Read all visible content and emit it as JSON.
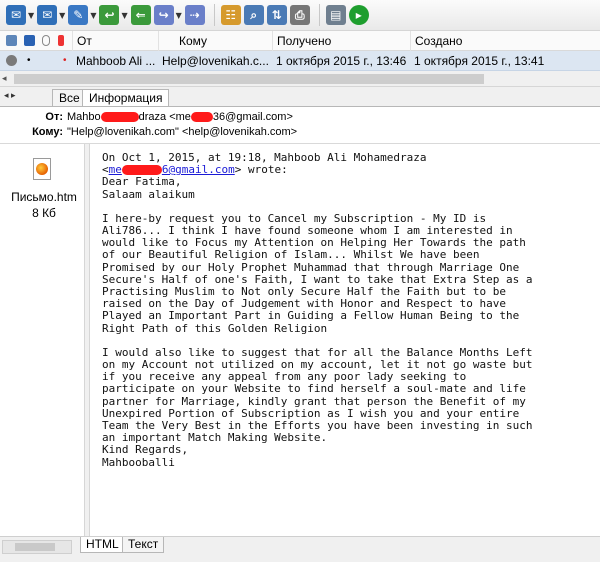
{
  "toolbar": {
    "buttons": [
      {
        "icon": "receive-mail-icon",
        "has_menu": true,
        "color": "#2f6fb8"
      },
      {
        "icon": "send-mail-icon",
        "has_menu": true,
        "color": "#2f6fb8"
      },
      {
        "icon": "new-message-icon",
        "has_menu": true,
        "color": "#3a78c4"
      },
      {
        "icon": "reply-icon",
        "has_menu": true,
        "color": "#3b9a3b"
      },
      {
        "icon": "reply-all-icon",
        "has_menu": false,
        "color": "#3b9a3b"
      },
      {
        "icon": "forward-icon",
        "has_menu": true,
        "color": "#6a7fc9"
      },
      {
        "icon": "redirect-icon",
        "has_menu": false,
        "color": "#6a7fc9"
      },
      {
        "icon": "address-book-icon",
        "has_menu": false,
        "color": "#d69a2d"
      },
      {
        "icon": "find-icon",
        "has_menu": false,
        "color": "#4a7ab5"
      },
      {
        "icon": "send-receive-icon",
        "has_menu": false,
        "color": "#4a7ab5"
      },
      {
        "icon": "print-icon",
        "has_menu": false,
        "color": "#777777"
      },
      {
        "icon": "trash-icon",
        "has_menu": false,
        "color": "#6f7f8f"
      },
      {
        "icon": "go-icon",
        "has_menu": false,
        "color": "#1e9e2e"
      }
    ]
  },
  "message_list": {
    "columns": {
      "from": "От",
      "to": "Кому",
      "received": "Получено",
      "created": "Создано"
    },
    "row": {
      "from": "Mahboob Ali ...",
      "to": "Help@lovenikah.c...",
      "received": "1 октября 2015 г., 13:46",
      "created": "1 октября 2015 г., 13:41"
    }
  },
  "view_tabs": [
    "Все",
    "Информация"
  ],
  "header": {
    "from_label": "От:",
    "from_value_start": "Mahbo",
    "from_value_mid": "draza <me",
    "from_value_end": "36@gmail.com>",
    "to_label": "Кому:",
    "to_value": "\"Help@lovenikah.com\" <help@lovenikah.com>"
  },
  "attachment": {
    "name": "Письмо.htm",
    "size": "8 Кб"
  },
  "body": {
    "quote_line1": "On Oct 1, 2015, at 19:18, Mahboob Ali Mohamedraza",
    "quote_line2_start": "<",
    "quote_link_start": "me",
    "quote_link_end": "6@gmail.com",
    "quote_line2_end": "> wrote:",
    "greeting": "Dear Fatima,",
    "salaam": "Salaam alaikum",
    "para1": [
      "I here-by request you to Cancel my Subscription - My ID is",
      "Ali786... I think I have found someone whom I am interested in",
      "would like to Focus my Attention on Helping Her Towards the path",
      "of our Beautiful Religion of Islam... Whilst We have been",
      "Promised by our Holy Prophet Muhammad that through Marriage One",
      "Secure's Half of one's Faith, I want to take that Extra Step as a",
      "Practising Muslim to Not only Secure Half the Faith but to be",
      "raised on the Day of Judgement with Honor and Respect to have",
      "Played an Important Part in Guiding a Fellow Human Being to the",
      "Right Path of this Golden Religion"
    ],
    "para2": [
      "I would also like to suggest that for all the Balance Months Left",
      "on my Account not utilized on my account, let it not go waste but",
      "if you receive any appeal from any poor lady seeking to",
      "participate on your Website to find herself a soul-mate and life",
      "partner for Marriage, kindly grant that person the Benefit of my",
      "Unexpired Portion of Subscription as I wish you and your entire",
      "Team the Very Best in the Efforts you have been investing in such",
      "an important Match Making Website."
    ],
    "closing1": "Kind Regards,",
    "closing2": "Mahbooballi"
  },
  "bottom_tabs": [
    "HTML",
    "Текст"
  ]
}
